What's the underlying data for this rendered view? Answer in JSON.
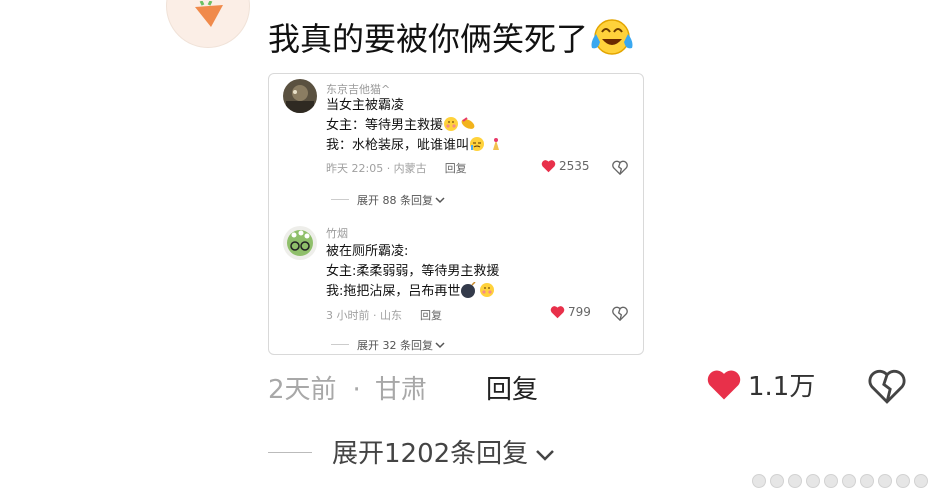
{
  "comment": {
    "text": "我真的要被你俩笑死了",
    "time": "2天前",
    "location": "甘肃",
    "reply_label": "回复",
    "likes": "1.1万",
    "expand_label": "展开1202条回复",
    "like_color": "#e8304a"
  },
  "screenshot_card": {
    "replies": [
      {
        "username": "东京吉他猫^",
        "lines": [
          "当女主被霸凌",
          "女主：等待男主救援",
          "我：水枪装尿，呲谁谁叫"
        ],
        "time": "昨天 22:05 · 内蒙古",
        "reply_label": "回复",
        "likes": "2535",
        "expand_label": "展开 88 条回复"
      },
      {
        "username": "竹烟",
        "lines": [
          "被在厕所霸凌:",
          "女主:柔柔弱弱，等待男主救援",
          "我:拖把沾屎，吕布再世"
        ],
        "time": "3 小时前 · 山东",
        "reply_label": "回复",
        "likes": "799",
        "expand_label": "展开 32 条回复"
      }
    ]
  },
  "icons": {
    "laugh_cry": "laughing-crying-emoji-icon",
    "heart": "heart-icon",
    "broken_heart": "broken-heart-icon",
    "chevron": "chevron-down-icon"
  }
}
